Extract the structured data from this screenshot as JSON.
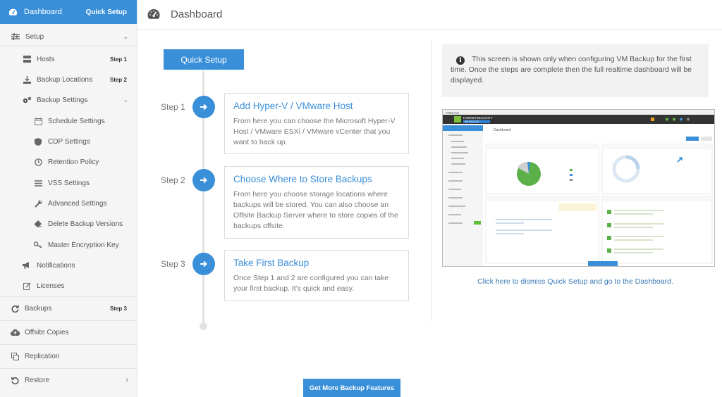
{
  "sidebar": {
    "header": {
      "title": "Dashboard",
      "quick_setup": "Quick Setup"
    },
    "setup": "Setup",
    "hosts": {
      "label": "Hosts",
      "badge": "Step 1"
    },
    "backup_locations": {
      "label": "Backup Locations",
      "badge": "Step 2"
    },
    "backup_settings": "Backup Settings",
    "schedule_settings": "Schedule Settings",
    "cdp_settings": "CDP Settings",
    "retention_policy": "Retention Policy",
    "vss_settings": "VSS Settings",
    "advanced_settings": "Advanced Settings",
    "delete_backup_versions": "Delete Backup Versions",
    "master_encryption_key": "Master Encryption Key",
    "notifications": "Notifications",
    "licenses": "Licenses",
    "backups": {
      "label": "Backups",
      "badge": "Step 3"
    },
    "offsite_copies": "Offsite Copies",
    "replication": "Replication",
    "restore": "Restore"
  },
  "header": {
    "title": "Dashboard"
  },
  "main": {
    "quick_setup_button": "Quick Setup",
    "steps": [
      {
        "label": "Step 1",
        "title": "Add Hyper-V / VMware Host",
        "desc": "From here you can choose the Microsoft Hyper-V Host / VMware ESXi / VMware vCenter that you want to back up."
      },
      {
        "label": "Step 2",
        "title": "Choose Where to Store Backups",
        "desc": "From here you choose storage locations where backups will be stored. You can also choose an Offsite Backup Server where to store copies of the backups offsite."
      },
      {
        "label": "Step 3",
        "title": "Take First Backup",
        "desc": "Once Step 1 and 2 are configured you can take your first backup. It's quick and easy."
      }
    ],
    "info_text": "This screen is shown only when configuring VM Backup for the first time. Once the steps are complete then the full realtime dashboard will be displayed.",
    "dismiss_link": "Click here to dismiss Quick Setup and go to the Dashboard.",
    "more_features_button": "Get More Backup Features"
  },
  "preview": {
    "window_title": "VMBackup",
    "brand": "HORNETSECURITY",
    "product": "VM BACKUP",
    "dashboard": "Dashboard"
  },
  "colors": {
    "accent": "#3a8fd9",
    "sidebar_bg": "#f5f5f5"
  }
}
